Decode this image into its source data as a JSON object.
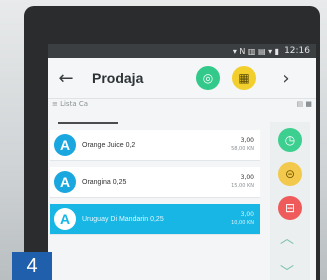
{
  "status_bar": {
    "signal": "▾ N ▥ ▤ ▾ ▮",
    "time": "12:16"
  },
  "app_bar": {
    "back_icon": "←",
    "title": "Prodaja",
    "green_btn": "◎",
    "yellow_btn": "▦",
    "next_icon": "›"
  },
  "filters": {
    "left": "≡ Lista Ca",
    "right": "▤ ■"
  },
  "items": [
    {
      "avatar": "A",
      "name": "Orange Juice 0,2",
      "value": "3,00",
      "sub": "58,00 KN"
    },
    {
      "avatar": "A",
      "name": "Orangina 0,25",
      "value": "3,00",
      "sub": "15,00 KN"
    },
    {
      "avatar": "A",
      "name": "Uruguay Di Mandarin 0,25",
      "value": "3,00",
      "sub": "10,00 KN"
    }
  ],
  "side_actions": {
    "btn1": "◷",
    "btn2": "⊝",
    "btn3": "⊟",
    "up": "︿",
    "down": "﹀"
  },
  "step_badge": "4"
}
